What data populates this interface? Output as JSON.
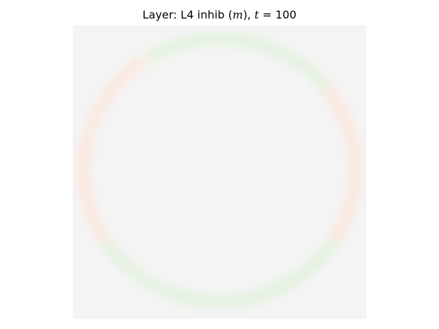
{
  "chart_data": {
    "type": "heatmap",
    "title": {
      "prefix": "Layer: L4 inhib (",
      "var": "m",
      "middle": "), ",
      "time_var": "t",
      "equals": " = ",
      "time_value": "100"
    },
    "axes_visible": false,
    "grid": false,
    "colorbar": false,
    "colormap": {
      "low": "#e0f2dc",
      "mid": "#f4f4f4",
      "high": "#fce6dc"
    },
    "background_value_color": "#f4f4f4",
    "features": [
      {
        "shape": "ring-segment",
        "sign": "positive",
        "angle_start": 60,
        "angle_end": 120,
        "intensity": 0.35
      },
      {
        "shape": "ring-segment",
        "sign": "negative",
        "angle_start": 125,
        "angle_end": 160,
        "intensity": 0.3
      },
      {
        "shape": "ring-segment",
        "sign": "negative",
        "angle_start": 165,
        "angle_end": 215,
        "intensity": 0.35
      },
      {
        "shape": "ring-segment",
        "sign": "positive",
        "angle_start": 215,
        "angle_end": 250,
        "intensity": 0.25
      },
      {
        "shape": "ring-segment",
        "sign": "positive",
        "angle_start": 250,
        "angle_end": 300,
        "intensity": 0.4
      },
      {
        "shape": "ring-segment",
        "sign": "positive",
        "angle_start": 300,
        "angle_end": 330,
        "intensity": 0.3
      },
      {
        "shape": "ring-segment",
        "sign": "negative",
        "angle_start": 330,
        "angle_end": 400,
        "intensity": 0.4
      },
      {
        "shape": "ring-segment",
        "sign": "positive",
        "angle_start": 40,
        "angle_end": 58,
        "intensity": 0.25
      }
    ]
  }
}
